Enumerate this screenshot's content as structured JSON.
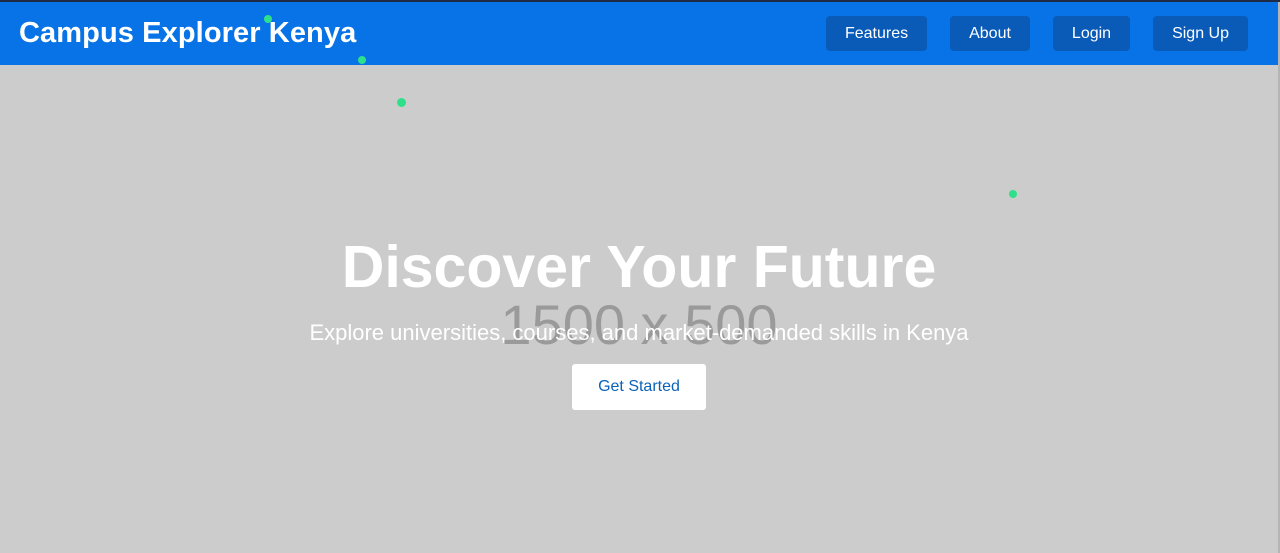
{
  "header": {
    "brand": "Campus Explorer Kenya",
    "nav": [
      {
        "label": "Features"
      },
      {
        "label": "About"
      },
      {
        "label": "Login"
      },
      {
        "label": "Sign Up"
      }
    ]
  },
  "hero": {
    "placeholder_text": "1500 x 500",
    "title": "Discover Your Future",
    "subtitle": "Explore universities, courses, and market-demanded skills in Kenya",
    "cta_label": "Get Started"
  },
  "colors": {
    "navbar": "#0873e6",
    "nav_button": "#0a5bb8",
    "hero_background": "#cccccc",
    "accent_dots": "#2fe08a",
    "cta_text": "#0a63b8"
  }
}
